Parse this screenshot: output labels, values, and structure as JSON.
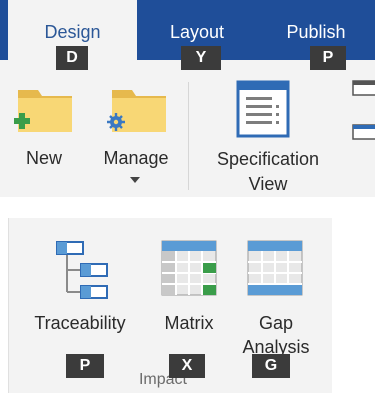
{
  "tabs": [
    {
      "label": "Design",
      "keytip": "D",
      "active": true
    },
    {
      "label": "Layout",
      "keytip": "Y",
      "active": false
    },
    {
      "label": "Publish",
      "keytip": "P",
      "active": false
    }
  ],
  "top_group": {
    "new_label": "New",
    "manage_label": "Manage",
    "spec_label_1": "Specification",
    "spec_label_2": "View"
  },
  "impact_group": {
    "label": "Impact",
    "traceability": {
      "label": "Traceability",
      "keytip": "P"
    },
    "matrix": {
      "label": "Matrix",
      "keytip": "X"
    },
    "gap": {
      "label_1": "Gap",
      "label_2": "Analysis",
      "keytip": "G"
    }
  },
  "colors": {
    "tab_bar": "#1f4e99",
    "ribbon_bg": "#f3f3f3",
    "active_tab_text": "#2b5797",
    "keytip_bg": "#3b3b3b",
    "folder": "#f8d775",
    "plus_green": "#3a9d4a",
    "gear_blue": "#3a78c2"
  }
}
